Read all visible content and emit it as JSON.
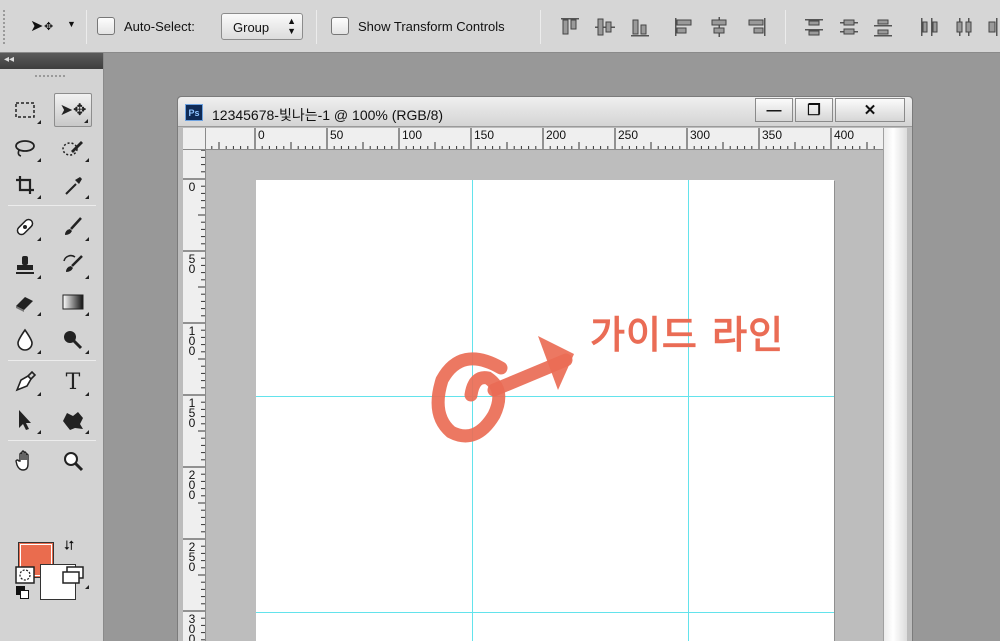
{
  "options_bar": {
    "auto_select_label": "Auto-Select:",
    "auto_select_checked": false,
    "auto_select_value": "Group",
    "show_transform_label": "Show Transform Controls",
    "show_transform_checked": false
  },
  "document": {
    "title": "12345678-빛나는-1 @ 100% (RGB/8)",
    "app_icon_text": "Ps",
    "minimize_label": "—",
    "restore_label": "❐",
    "close_label": "✕",
    "ruler_h_labels": [
      "0",
      "50",
      "100",
      "150",
      "200",
      "250",
      "300",
      "350",
      "400"
    ],
    "ruler_v_labels": [
      "0",
      "50",
      "100",
      "150",
      "200",
      "250",
      "300"
    ]
  },
  "annotation": {
    "text": "가이드 라인",
    "color": "#ea6c55"
  },
  "colors": {
    "foreground": "#ea6c4e",
    "background": "#ffffff",
    "guide": "#63e3ec"
  },
  "tools": {
    "icons": [
      "rectangular-marquee-icon",
      "move-icon",
      "lasso-icon",
      "quick-selection-icon",
      "crop-icon",
      "eyedropper-icon",
      "healing-brush-icon",
      "brush-icon",
      "clone-stamp-icon",
      "history-brush-icon",
      "eraser-icon",
      "gradient-icon",
      "blur-icon",
      "dodge-icon",
      "pen-icon",
      "type-icon",
      "path-selection-icon",
      "custom-shape-icon",
      "hand-icon",
      "zoom-icon"
    ],
    "type_label": "T"
  }
}
